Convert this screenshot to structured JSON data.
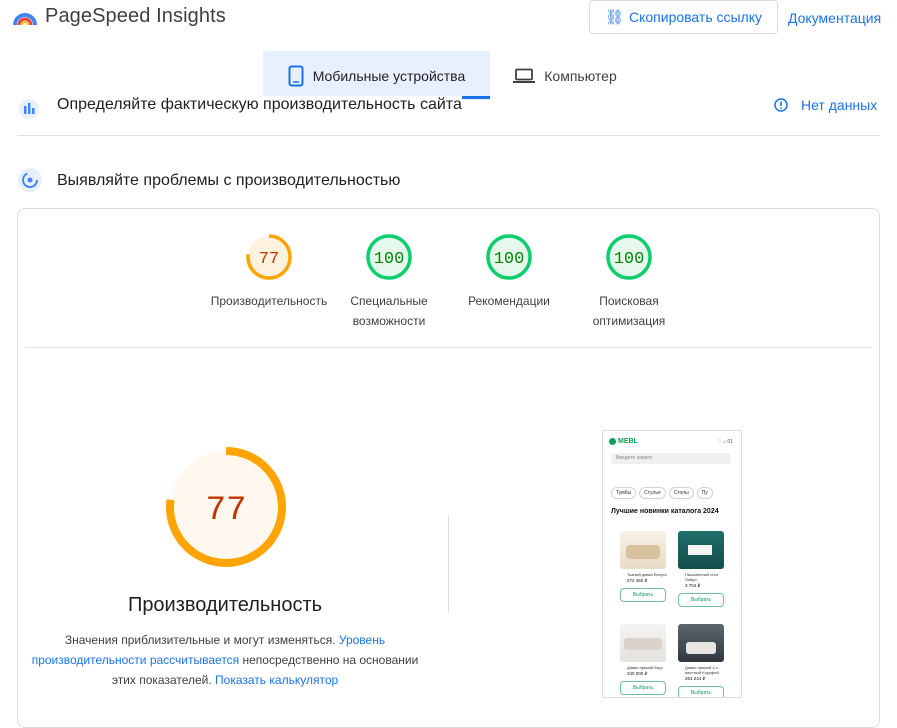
{
  "header": {
    "brand": "PageSpeed Insights",
    "copy_link_label": "Скопировать ссылку",
    "docs_label": "Документация"
  },
  "tabs": {
    "mobile_label": "Мобильные устройства",
    "desktop_label": "Компьютер",
    "active": "mobile"
  },
  "field_data": {
    "title": "Определяйте фактическую производительность сайта",
    "status_label": "Нет данных"
  },
  "lab_data": {
    "title": "Выявляйте проблемы с производительностью"
  },
  "scores": [
    {
      "value": "77",
      "numeric": 77,
      "label_line1": "Производительность",
      "label_line2": "",
      "color": "#ffa400"
    },
    {
      "value": "100",
      "numeric": 100,
      "label_line1": "Специальные",
      "label_line2": "возможности",
      "color": "#0cce6b"
    },
    {
      "value": "100",
      "numeric": 100,
      "label_line1": "Рекомендации",
      "label_line2": "",
      "color": "#0cce6b"
    },
    {
      "value": "100",
      "numeric": 100,
      "label_line1": "Поисковая",
      "label_line2": "оптимизация",
      "color": "#0cce6b"
    }
  ],
  "performance": {
    "score": "77",
    "score_numeric": 77,
    "title": "Производительность",
    "desc_part1": "Значения приблизительные и могут изменяться. ",
    "desc_link1": "Уровень производительности рассчитывается",
    "desc_part2": " непосредственно на основании этих показателей. ",
    "desc_link2": "Показать калькулятор"
  },
  "screenshot": {
    "logo": "MEBL",
    "icons_text": "♡ ⌂ 01",
    "search_placeholder": "Введите запрос",
    "chips": [
      "Тумбы",
      "Стулья",
      "Столы",
      "Пу"
    ],
    "heading": "Лучшие новинки каталога 2024",
    "products": [
      {
        "name": "Тканый диван Белуга",
        "price": "272 460 ₽",
        "button": "Выбрать"
      },
      {
        "name": "Письменный стол Либри",
        "price": "3 704 ₽",
        "button": "Выбрать"
      },
      {
        "name": "Диван прямой Берг",
        "price": "340 000 ₽",
        "button": "Выбрать"
      },
      {
        "name": "Диван прямой 4-х местный Коруфей",
        "price": "261 244 ₽",
        "button": "Выбрать"
      }
    ]
  },
  "colors": {
    "accent": "#1a73e8",
    "average": "#ffa400",
    "good": "#0cce6b"
  }
}
